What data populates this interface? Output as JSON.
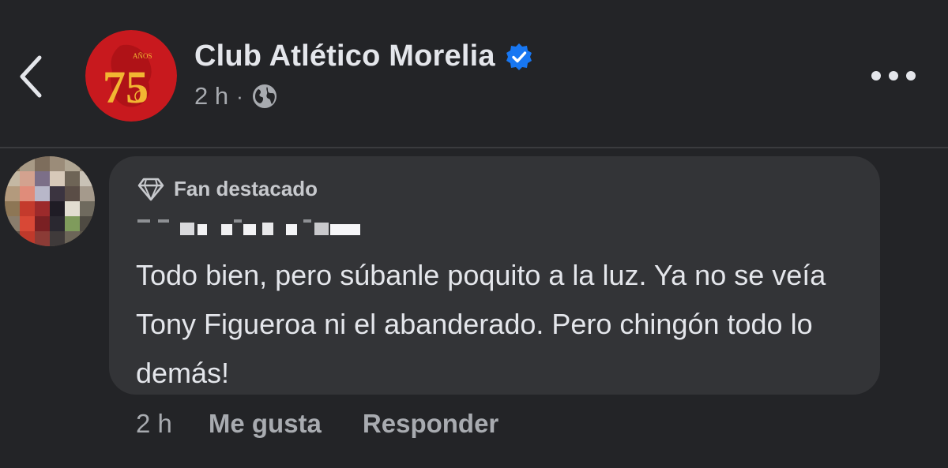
{
  "header": {
    "page_name": "Club Atlético Morelia",
    "post_time": "2 h",
    "separator": "·",
    "back_icon": "chevron-left-icon",
    "verified_icon": "verified-badge-icon",
    "privacy_icon": "globe-icon",
    "more_icon": "more-horizontal-icon",
    "logo_text": "75",
    "logo_small_text": "AÑOS"
  },
  "comment": {
    "badge_icon": "diamond-icon",
    "badge_label": "Fan destacado",
    "author_name_redacted": true,
    "text": "Todo bien, pero súbanle poquito a la luz. Ya no se veía Tony Figueroa ni el abanderado. Pero chingón todo lo demás!",
    "time": "2 h",
    "like_label": "Me gusta",
    "reply_label": "Responder"
  },
  "colors": {
    "background": "#232427",
    "bubble": "#333437",
    "text": "#e4e6eb",
    "muted": "#a8abb0",
    "verified_blue": "#1877f2",
    "logo_red": "#c8191e",
    "logo_gold": "#f2b632"
  }
}
